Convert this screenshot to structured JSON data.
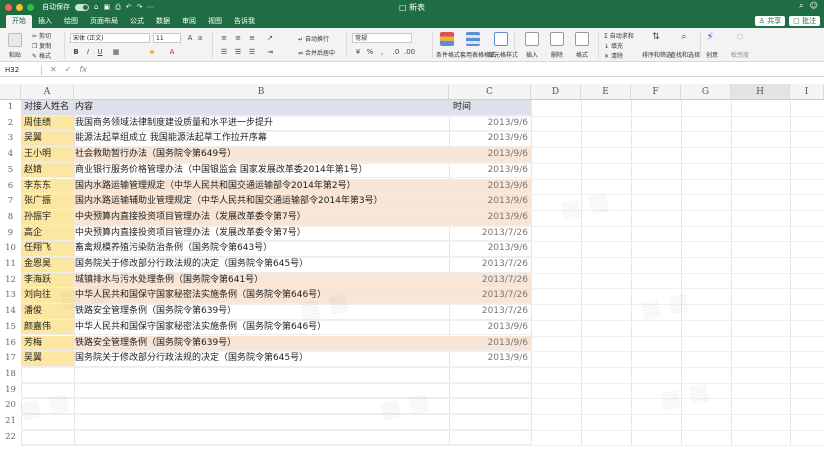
{
  "window": {
    "title": "□ 新表",
    "quick_access": [
      "自动保存"
    ],
    "right_icons": [
      "⌕",
      "☺"
    ]
  },
  "ribbon_tabs": [
    "开始",
    "插入",
    "绘图",
    "页面布局",
    "公式",
    "数据",
    "审阅",
    "视图",
    "告诉我"
  ],
  "ribbon_right": [
    "♙ 共享",
    "▢ 批注"
  ],
  "ribbon": {
    "paste": "粘贴",
    "cut": "剪切",
    "copy": "复制",
    "format": "格式",
    "font_name": "宋体 (正文)",
    "font_size": "11",
    "wrap": "自动换行",
    "merge": "合并后居中",
    "number_format": "常规",
    "cond_format": "条件格式",
    "table_format": "套用表格格式",
    "cell_style": "单元格样式",
    "insert": "插入",
    "delete": "删除",
    "format_cells": "格式",
    "autosum": "自动求和",
    "fill": "填充",
    "clear": "清除",
    "sort_filter": "排序和筛选",
    "find_select": "查找和选择",
    "ideas": "创意",
    "sensitivity": "敏感度"
  },
  "formula_bar": {
    "name_box": "H32",
    "fx": "fx",
    "value": ""
  },
  "columns": [
    "A",
    "B",
    "C",
    "D",
    "E",
    "F",
    "G",
    "H",
    "I"
  ],
  "selected_column": "H",
  "rows": [
    {
      "num": "1",
      "a": "对接人姓名",
      "b": "内容",
      "c": "时间",
      "hl": false
    },
    {
      "num": "2",
      "a": "周佳绩",
      "b": "我国商务领域法律制度建设质量和水平进一步提升",
      "c": "2013/9/6",
      "hl": false
    },
    {
      "num": "3",
      "a": "吴翼",
      "b": "能源法起草组成立 我国能源法起草工作拉开序幕",
      "c": "2013/9/6",
      "hl": false
    },
    {
      "num": "4",
      "a": "王小明",
      "b": "社会救助暂行办法（国务院令第649号）",
      "c": "2013/9/6",
      "hl": true
    },
    {
      "num": "5",
      "a": "赵婧",
      "b": "商业银行服务价格管理办法（中国银监会 国家发展改革委2014年第1号）",
      "c": "2013/9/6",
      "hl": false
    },
    {
      "num": "6",
      "a": "李东东",
      "b": "国内水路运输管理规定（中华人民共和国交通运输部令2014年第2号）",
      "c": "2013/9/6",
      "hl": true
    },
    {
      "num": "7",
      "a": "张广振",
      "b": "国内水路运输辅助业管理规定（中华人民共和国交通运输部令2014年第3号）",
      "c": "2013/9/6",
      "hl": true
    },
    {
      "num": "8",
      "a": "孙振宇",
      "b": "中央预算内直接投资项目管理办法（发展改革委令第7号）",
      "c": "2013/9/6",
      "hl": true
    },
    {
      "num": "9",
      "a": "高企",
      "b": "中央预算内直接投资项目管理办法（发展改革委令第7号）",
      "c": "2013/7/26",
      "hl": false
    },
    {
      "num": "10",
      "a": "任翔飞",
      "b": "畜禽规模养殖污染防治条例（国务院令第643号）",
      "c": "2013/9/6",
      "hl": false
    },
    {
      "num": "11",
      "a": "金恩昊",
      "b": "国务院关于修改部分行政法规的决定（国务院令第645号）",
      "c": "2013/7/26",
      "hl": false
    },
    {
      "num": "12",
      "a": "李海跃",
      "b": "城镇排水与污水处理条例（国务院令第641号）",
      "c": "2013/7/26",
      "hl": true
    },
    {
      "num": "13",
      "a": "刘向往",
      "b": "中华人民共和国保守国家秘密法实施条例（国务院令第646号）",
      "c": "2013/7/26",
      "hl": true
    },
    {
      "num": "14",
      "a": "潘俊",
      "b": "铁路安全管理条例（国务院令第639号）",
      "c": "2013/7/26",
      "hl": false
    },
    {
      "num": "15",
      "a": "颜嘉伟",
      "b": "中华人民共和国保守国家秘密法实施条例（国务院令第646号）",
      "c": "2013/9/6",
      "hl": false
    },
    {
      "num": "16",
      "a": "芳梅",
      "b": "铁路安全管理条例（国务院令第639号）",
      "c": "2013/9/6",
      "hl": true
    },
    {
      "num": "17",
      "a": "吴翼",
      "b": "国务院关于修改部分行政法规的决定（国务院令第645号）",
      "c": "2013/9/6",
      "hl": false
    },
    {
      "num": "18",
      "a": "",
      "b": "",
      "c": "",
      "hl": false
    },
    {
      "num": "19",
      "a": "",
      "b": "",
      "c": "",
      "hl": false
    },
    {
      "num": "20",
      "a": "",
      "b": "",
      "c": "",
      "hl": false
    },
    {
      "num": "21",
      "a": "",
      "b": "",
      "c": "",
      "hl": false
    },
    {
      "num": "22",
      "a": "",
      "b": "",
      "c": "",
      "hl": false
    }
  ],
  "colors": {
    "title_green": "#1f6e43",
    "name_col": "#fbe7a1",
    "highlight_row": "#f8e5d5",
    "header_row": "#dfe1ea"
  }
}
